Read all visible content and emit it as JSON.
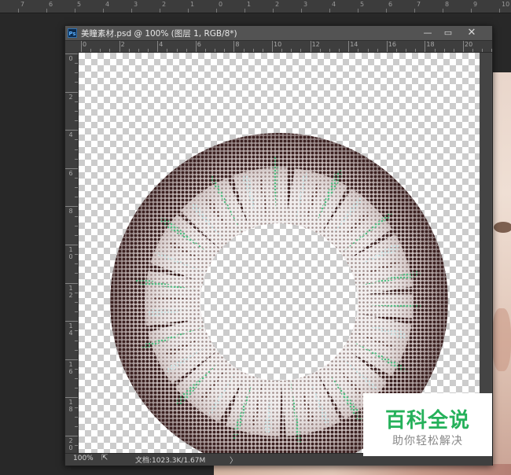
{
  "workspace": {
    "top_ruler_labels": [
      "7",
      "6",
      "5",
      "4",
      "3",
      "2",
      "1",
      "0",
      "1",
      "2",
      "3",
      "4",
      "5",
      "6",
      "7",
      "8",
      "9",
      "10"
    ]
  },
  "document": {
    "app_icon": "Ps",
    "title": "美瞳素材.psd @ 100% (图层 1, RGB/8*)",
    "min_icon": "minimize-icon",
    "max_icon": "maximize-icon",
    "close_icon": "close-icon",
    "h_ruler_labels": [
      "0",
      "2",
      "4",
      "6",
      "8",
      "10",
      "12",
      "14",
      "16",
      "18",
      "20"
    ],
    "v_ruler_labels": [
      "0",
      "2",
      "4",
      "6",
      "8",
      "10",
      "12",
      "14",
      "16",
      "18",
      "20"
    ]
  },
  "status_bar": {
    "zoom": "100%",
    "doc_info": "文档:1023.3K/1.67M",
    "arrow": "〉"
  },
  "watermark": {
    "title": "百科全说",
    "subtitle": "助你轻松解决"
  },
  "colors": {
    "lens_outer": "#3b2020",
    "lens_accent": "#4fbf83",
    "watermark_green": "#25b15a"
  }
}
